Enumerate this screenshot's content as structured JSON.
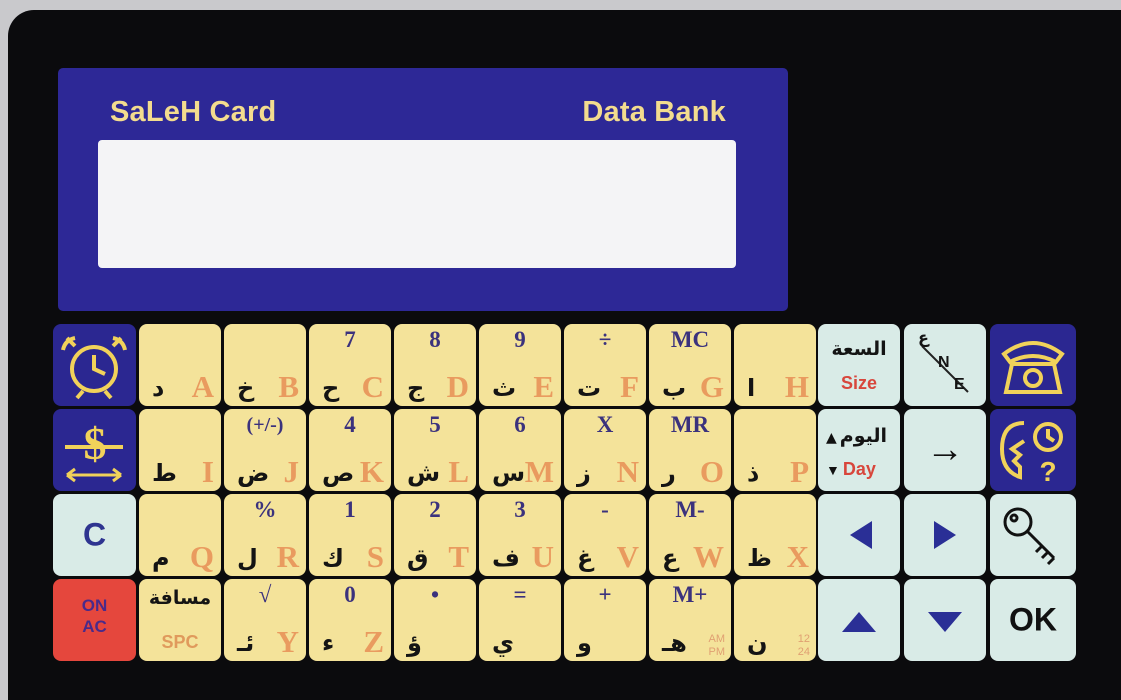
{
  "brand": {
    "left": "SaLeH Card",
    "right": "Data Bank"
  },
  "rows": [
    [
      {
        "num": "",
        "ar": "د",
        "en": "A"
      },
      {
        "num": "",
        "ar": "خ",
        "en": "B"
      },
      {
        "num": "7",
        "ar": "ح",
        "en": "C"
      },
      {
        "num": "8",
        "ar": "ج",
        "en": "D"
      },
      {
        "num": "9",
        "ar": "ث",
        "en": "E"
      },
      {
        "num": "÷",
        "ar": "ت",
        "en": "F"
      },
      {
        "num": "MC",
        "ar": "ب",
        "en": "G"
      },
      {
        "num": "",
        "ar": "ا",
        "en": "H"
      }
    ],
    [
      {
        "num": "",
        "ar": "ط",
        "en": "I"
      },
      {
        "num": "(+/-)",
        "ar": "ض",
        "en": "J"
      },
      {
        "num": "4",
        "ar": "ص",
        "en": "K"
      },
      {
        "num": "5",
        "ar": "ش",
        "en": "L"
      },
      {
        "num": "6",
        "ar": "س",
        "en": "M"
      },
      {
        "num": "X",
        "ar": "ز",
        "en": "N"
      },
      {
        "num": "MR",
        "ar": "ر",
        "en": "O"
      },
      {
        "num": "",
        "ar": "ذ",
        "en": "P"
      }
    ],
    [
      {
        "num": "",
        "ar": "م",
        "en": "Q"
      },
      {
        "num": "%",
        "ar": "ل",
        "en": "R"
      },
      {
        "num": "1",
        "ar": "ك",
        "en": "S"
      },
      {
        "num": "2",
        "ar": "ق",
        "en": "T"
      },
      {
        "num": "3",
        "ar": "ف",
        "en": "U"
      },
      {
        "num": "-",
        "ar": "غ",
        "en": "V"
      },
      {
        "num": "M-",
        "ar": "ع",
        "en": "W"
      },
      {
        "num": "",
        "ar": "ظ",
        "en": "X"
      }
    ]
  ],
  "row4": {
    "spc_ar": "مسافة",
    "spc_en": "SPC",
    "keys": [
      {
        "num": "√",
        "ar": "ئـ",
        "en": "Y"
      },
      {
        "num": "0",
        "ar": "ء",
        "en": "Z"
      },
      {
        "num": "•",
        "ar": "ؤ",
        "en": ""
      },
      {
        "num": "=",
        "ar": "ي",
        "en": ""
      },
      {
        "num": "+",
        "ar": "و",
        "en": ""
      },
      {
        "num": "M+",
        "ar": "هـ",
        "en": ""
      },
      {
        "num": "",
        "ar": "ن",
        "en": ""
      }
    ],
    "ampm": {
      "top": "AM",
      "bottom": "PM"
    },
    "h24": {
      "top": "12",
      "bottom": "24"
    }
  },
  "left_keys": {
    "c_label": "C",
    "on_label": "ON",
    "ac_label": "AC"
  },
  "right_keys": {
    "size_ar": "السعة",
    "size_en": "Size",
    "ne_top": "ع",
    "ne_mid": "N",
    "ne_bottom": "E",
    "day_ar": "اليوم",
    "day_en": "Day",
    "enter_glyph": "→",
    "ok_label": "OK"
  },
  "colors": {
    "card": "#0b0b0d",
    "panel": "#2d2896",
    "brand_text": "#f3dc8e",
    "key_yellow": "#f4e39a",
    "key_mint": "#d9ebe7",
    "key_navy": "#2b2791",
    "key_red": "#e5473d",
    "latin_letter": "#e99b5f",
    "arrow_blue": "#2a2f96",
    "icon_gold": "#f1d25a"
  },
  "icons": [
    "alarm-clock-icon",
    "dollar-exchange-icon",
    "telephone-icon",
    "time-help-icon",
    "key-icon",
    "arrow-left-icon",
    "arrow-right-icon",
    "arrow-up-icon",
    "arrow-down-icon"
  ]
}
